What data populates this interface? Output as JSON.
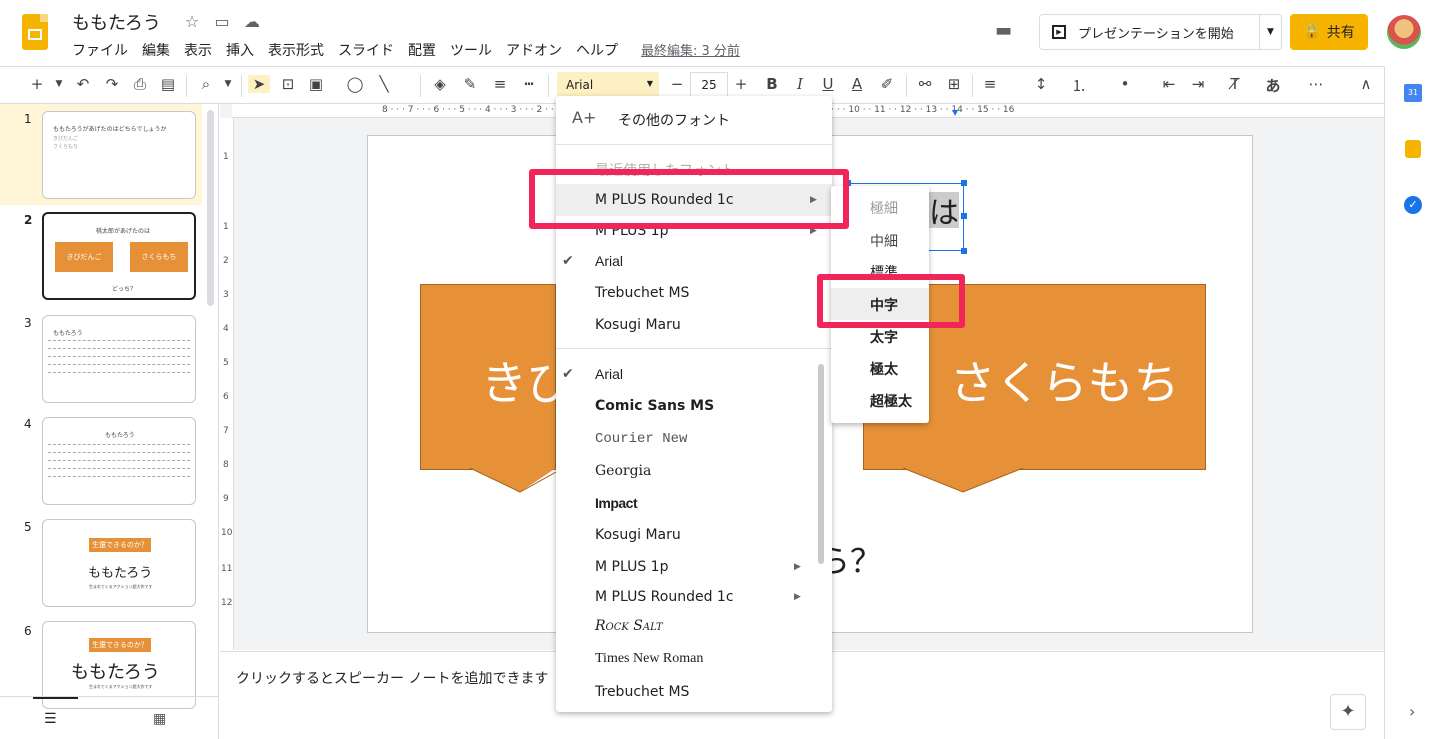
{
  "app": {
    "title": "ももたろう",
    "last_edit": "最終編集: 3 分前"
  },
  "menubar": [
    "ファイル",
    "編集",
    "表示",
    "挿入",
    "表示形式",
    "スライド",
    "配置",
    "ツール",
    "アドオン",
    "ヘルプ"
  ],
  "header": {
    "present_label": "プレゼンテーションを開始",
    "share_label": "共有"
  },
  "toolbar": {
    "font": "Arial",
    "size": "25",
    "ime": "あ"
  },
  "slides": [
    {
      "num": "1",
      "title": "ももたろうがあげたのはどちらでしょうか",
      "lines": [
        "きびだんご",
        "さくらもち"
      ]
    },
    {
      "num": "2",
      "title": "桃太郎があげたのは",
      "left": "きびだんご",
      "right": "さくらもち",
      "bottom": "どっち？"
    },
    {
      "num": "3",
      "title": "ももたろう"
    },
    {
      "num": "4",
      "title": "ももたろう"
    },
    {
      "num": "5",
      "callout": "生還できるのか？",
      "title": "ももたろう",
      "sub": "生まれてくるアクション超大作です"
    },
    {
      "num": "6",
      "callout": "生還できるのか？",
      "title": "ももたろう",
      "sub": "生まれてくるアクション超大作です"
    }
  ],
  "canvas": {
    "left_text": "きび",
    "right_text": "さくらもち",
    "bottom_text": "ら？",
    "title_frag": "は"
  },
  "notes": {
    "placeholder": "クリックするとスピーカー ノートを追加できます"
  },
  "font_menu": {
    "more_fonts": "その他のフォント",
    "recent_header": "最近使用したフォント",
    "recent": [
      "M PLUS Rounded 1c",
      "M PLUS 1p",
      "Arial",
      "Trebuchet MS",
      "Kosugi Maru"
    ],
    "all": [
      "Arial",
      "Comic Sans MS",
      "Courier New",
      "Georgia",
      "Impact",
      "Kosugi Maru",
      "M PLUS 1p",
      "M PLUS Rounded 1c",
      "Rock Salt",
      "Times New Roman",
      "Trebuchet MS"
    ]
  },
  "weight_menu": [
    "極細",
    "中細",
    "標準",
    "中字",
    "太字",
    "極太",
    "超極太"
  ],
  "colors": {
    "accent": "#f4b400",
    "shape": "#e69138",
    "highlight": "#f2255b"
  }
}
